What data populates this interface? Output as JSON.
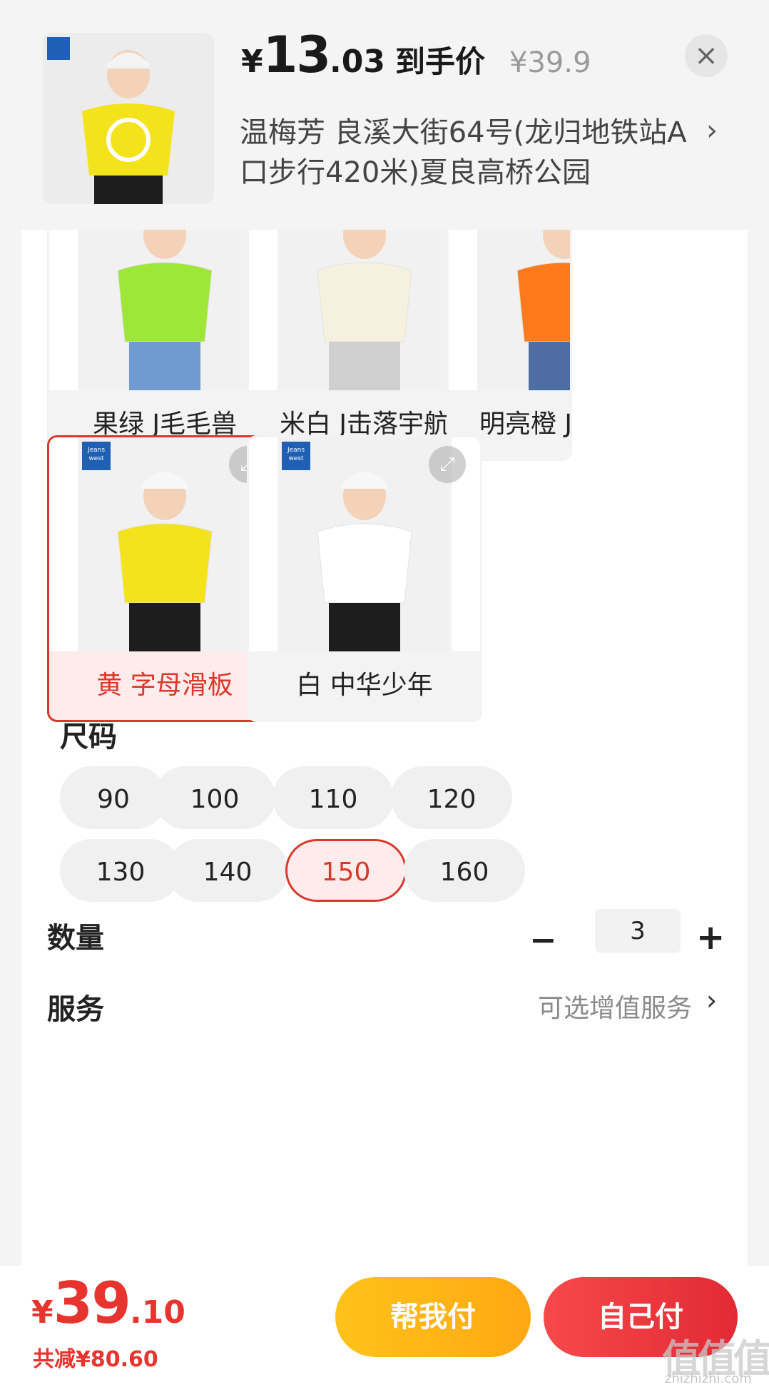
{
  "header": {
    "price_currency": "¥",
    "price_integer": "13",
    "price_decimal": ".03",
    "price_tag": "到手价",
    "original_price": "¥39.9",
    "close_icon": "close-icon",
    "address": "温梅芳  良溪大街64号(龙归地铁站A口步行420米)夏良高桥公园",
    "address_chevron": "›"
  },
  "variants": [
    {
      "label": "果绿 J毛毛兽",
      "shirt_color": "#9ee637",
      "pants_color": "#6f9bd0",
      "selected": false
    },
    {
      "label": "米白 J击落宇航",
      "shirt_color": "#f6f1de",
      "pants_color": "#cfcfcf",
      "selected": false
    },
    {
      "label": "明亮橙 J背包熊",
      "shirt_color": "#ff7a1a",
      "pants_color": "#4e6ea3",
      "selected": false
    },
    {
      "label": "黄 字母滑板",
      "shirt_color": "#f4e31a",
      "pants_color": "#1d1d1d",
      "selected": true
    },
    {
      "label": "白 中华少年",
      "shirt_color": "#ffffff",
      "pants_color": "#1d1d1d",
      "selected": false
    }
  ],
  "brand_logo_text": "Jeans west",
  "expand_icon": "expand-icon",
  "size_section": {
    "title": "尺码",
    "sizes": [
      "90",
      "100",
      "110",
      "120",
      "130",
      "140",
      "150",
      "160"
    ],
    "selected": "150"
  },
  "quantity": {
    "title": "数量",
    "minus": "−",
    "value": "3",
    "plus": "+"
  },
  "service": {
    "title": "服务",
    "hint": "可选增值服务",
    "chevron": "›"
  },
  "bottom_bar": {
    "total_currency": "¥",
    "total_integer": "39",
    "total_decimal": ".10",
    "saving": "共减¥80.60",
    "help_pay": "帮我付",
    "self_pay": "自己付"
  },
  "watermark": {
    "text": "值值值",
    "url": "zhizhizhi.com"
  },
  "colors": {
    "accent_red": "#e8342e",
    "selected_border": "#d8392b",
    "help_button": "#ffb516"
  }
}
